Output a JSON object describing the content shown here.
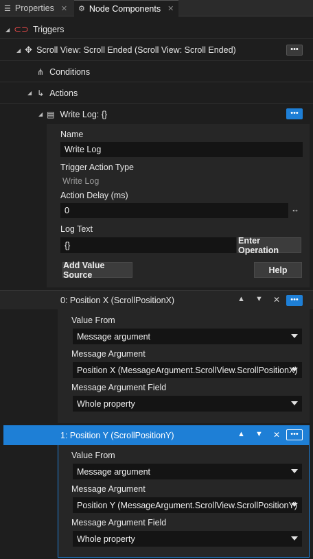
{
  "tabs": [
    {
      "label": "Properties",
      "close": "✕"
    },
    {
      "label": "Node Components",
      "close": "✕"
    }
  ],
  "tree": {
    "triggers": "Triggers",
    "trigger_item": "Scroll View: Scroll Ended (Scroll View: Scroll Ended)",
    "conditions": "Conditions",
    "actions": "Actions",
    "write_log": "Write Log: {}",
    "more": "•••"
  },
  "action_props": {
    "name_label": "Name",
    "name_value": "Write Log",
    "type_label": "Trigger Action Type",
    "type_value": "Write Log",
    "delay_label": "Action Delay (ms)",
    "delay_value": "0",
    "log_label": "Log Text",
    "log_value": "{}",
    "enter_operation": "Enter Operation",
    "add_value_source": "Add Value Source",
    "help": "Help"
  },
  "value_sources": [
    {
      "title": "0: Position X (ScrollPositionX)",
      "value_from_label": "Value From",
      "value_from": "Message argument",
      "message_argument_label": "Message Argument",
      "message_argument": "Position X (MessageArgument.ScrollView.ScrollPositionX)",
      "field_label": "Message Argument Field",
      "field": "Whole property",
      "selected": false
    },
    {
      "title": "1: Position Y (ScrollPositionY)",
      "value_from_label": "Value From",
      "value_from": "Message argument",
      "message_argument_label": "Message Argument",
      "message_argument": "Position Y (MessageArgument.ScrollView.ScrollPositionY)",
      "field_label": "Message Argument Field",
      "field": "Whole property",
      "selected": true
    }
  ],
  "colors": {
    "background": "#1e1e1e",
    "panel": "#262626",
    "accent": "#1e7fd6",
    "trigger_icon": "#e04848"
  }
}
